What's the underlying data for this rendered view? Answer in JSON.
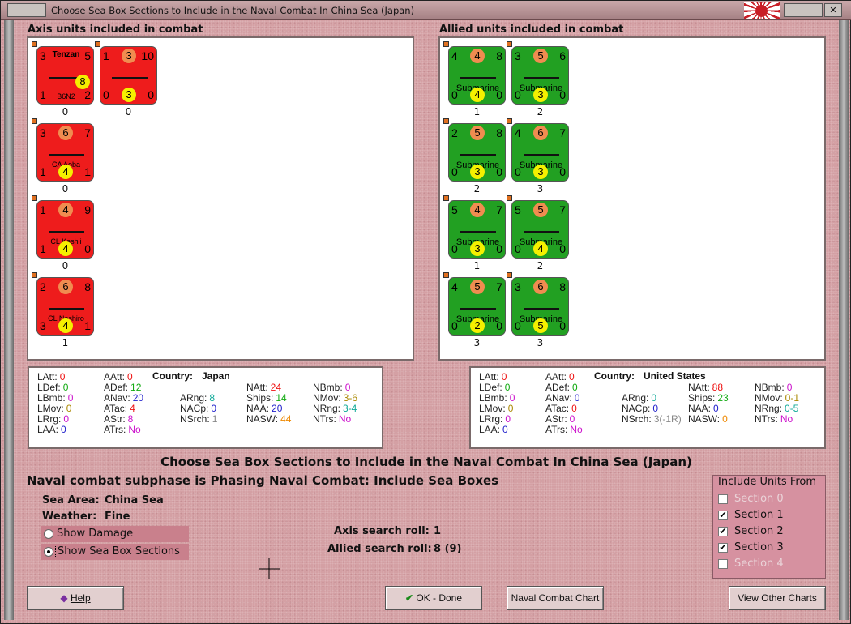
{
  "window": {
    "title": "Choose Sea Box Sections to Include in the Naval Combat In China Sea (Japan)",
    "close": "✕"
  },
  "axis_panel": {
    "label": "Axis units included in combat",
    "counters": [
      {
        "left": "3",
        "right": "5",
        "top_center": "Tenzan",
        "name": "B6N2",
        "bottom_left": "1",
        "bottom_right": "2",
        "yellow": "8",
        "below": "0",
        "kind": "air"
      },
      {
        "left": "1",
        "mid": "3",
        "right": "10",
        "name": "",
        "bottom_left": "0",
        "yellow": "3",
        "bottom_right": "0",
        "below": "0",
        "kind": "carrier"
      },
      {
        "left": "3",
        "mid": "6",
        "right": "7",
        "name": "CA Aoba",
        "bottom_left": "1",
        "yellow": "4",
        "bottom_right": "1",
        "below": "0"
      },
      {
        "left": "1",
        "mid": "4",
        "right": "9",
        "name": "CL Kashii",
        "bottom_left": "1",
        "yellow": "4",
        "bottom_right": "0",
        "below": "0"
      },
      {
        "left": "2",
        "mid": "6",
        "right": "8",
        "name": "CL Noshiro",
        "bottom_left": "3",
        "yellow": "4",
        "bottom_right": "1",
        "below": "1"
      }
    ]
  },
  "allied_panel": {
    "label": "Allied units included in combat",
    "counters": [
      {
        "left": "4",
        "mid": "4",
        "right": "8",
        "name": "Submarine",
        "bottom_left": "0",
        "yellow": "4",
        "bottom_right": "0",
        "below": "1"
      },
      {
        "left": "3",
        "mid": "5",
        "right": "6",
        "name": "Submarine",
        "bottom_left": "0",
        "yellow": "3",
        "bottom_right": "0",
        "below": "2"
      },
      {
        "left": "2",
        "mid": "5",
        "right": "8",
        "name": "Submarine",
        "bottom_left": "0",
        "yellow": "3",
        "bottom_right": "0",
        "below": "2"
      },
      {
        "left": "4",
        "mid": "6",
        "right": "7",
        "name": "Submarine",
        "bottom_left": "0",
        "yellow": "3",
        "bottom_right": "0",
        "below": "3"
      },
      {
        "left": "5",
        "mid": "4",
        "right": "7",
        "name": "Submarine",
        "bottom_left": "0",
        "yellow": "3",
        "bottom_right": "0",
        "below": "1"
      },
      {
        "left": "5",
        "mid": "5",
        "right": "7",
        "name": "Submarine",
        "bottom_left": "0",
        "yellow": "4",
        "bottom_right": "0",
        "below": "2"
      },
      {
        "left": "4",
        "mid": "5",
        "right": "7",
        "name": "Submarine",
        "bottom_left": "0",
        "yellow": "2",
        "bottom_right": "0",
        "below": "3"
      },
      {
        "left": "3",
        "mid": "6",
        "right": "8",
        "name": "Submarine",
        "bottom_left": "0",
        "yellow": "5",
        "bottom_right": "0",
        "below": "3"
      }
    ]
  },
  "axis_stats": {
    "country_label": "Country:",
    "country": "Japan",
    "stats": [
      [
        "LAtt:",
        "0",
        "#e11"
      ],
      [
        "LDef:",
        "0",
        "#1a1"
      ],
      [
        "LBmb:",
        "0",
        "#c1c"
      ],
      [
        "LMov:",
        "0",
        "#aa8800"
      ],
      [
        "LRrg:",
        "0",
        "#c1c"
      ],
      [
        "LAA:",
        "0",
        "#22c"
      ],
      [
        "AAtt:",
        "0",
        "#e11"
      ],
      [
        "ADef:",
        "12",
        "#1a1"
      ],
      [
        "ANav:",
        "20",
        "#22c"
      ],
      [
        "ATac:",
        "4",
        "#e11"
      ],
      [
        "AStr:",
        "8",
        "#c1c"
      ],
      [
        "ATrs:",
        "No",
        "#c1c"
      ],
      [
        "ARng:",
        "8",
        "#1a9"
      ],
      [
        "NACp:",
        "0",
        "#22c"
      ],
      [
        "NSrch:",
        "1",
        "#888"
      ],
      [
        "NAtt:",
        "24",
        "#e11"
      ],
      [
        "Ships:",
        "14",
        "#1a1"
      ],
      [
        "NAA:",
        "20",
        "#22c"
      ],
      [
        "NASW:",
        "44",
        "#e80"
      ],
      [
        "NBmb:",
        "0",
        "#c1c"
      ],
      [
        "NMov:",
        "3-6",
        "#aa8800"
      ],
      [
        "NRng:",
        "3-4",
        "#1a9"
      ],
      [
        "NTrs:",
        "No",
        "#c1c"
      ]
    ]
  },
  "allied_stats": {
    "country_label": "Country:",
    "country": "United States",
    "stats": [
      [
        "LAtt:",
        "0",
        "#e11"
      ],
      [
        "LDef:",
        "0",
        "#1a1"
      ],
      [
        "LBmb:",
        "0",
        "#c1c"
      ],
      [
        "LMov:",
        "0",
        "#aa8800"
      ],
      [
        "LRrg:",
        "0",
        "#c1c"
      ],
      [
        "LAA:",
        "0",
        "#22c"
      ],
      [
        "AAtt:",
        "0",
        "#e11"
      ],
      [
        "ADef:",
        "0",
        "#1a1"
      ],
      [
        "ANav:",
        "0",
        "#22c"
      ],
      [
        "ATac:",
        "0",
        "#e11"
      ],
      [
        "AStr:",
        "0",
        "#c1c"
      ],
      [
        "ATrs:",
        "No",
        "#c1c"
      ],
      [
        "ARng:",
        "0",
        "#1a9"
      ],
      [
        "NACp:",
        "0",
        "#22c"
      ],
      [
        "NSrch:",
        "3(-1R)",
        "#888"
      ],
      [
        "NAtt:",
        "88",
        "#e11"
      ],
      [
        "Ships:",
        "23",
        "#1a1"
      ],
      [
        "NAA:",
        "0",
        "#22c"
      ],
      [
        "NASW:",
        "0",
        "#e80"
      ],
      [
        "NBmb:",
        "0",
        "#c1c"
      ],
      [
        "NMov:",
        "0-1",
        "#aa8800"
      ],
      [
        "NRng:",
        "0-5",
        "#1a9"
      ],
      [
        "NTrs:",
        "No",
        "#c1c"
      ]
    ]
  },
  "heading": "Choose Sea Box Sections to Include in the Naval Combat In China Sea (Japan)",
  "subphase": "Naval combat subphase is Phasing Naval Combat: Include Sea Boxes",
  "sea_area_label": "Sea Area:",
  "sea_area": "China Sea",
  "weather_label": "Weather:",
  "weather": "Fine",
  "radio1": "Show Damage",
  "radio2": "Show Sea Box Sections",
  "axis_roll_label": "Axis search roll:",
  "axis_roll": "1",
  "allied_roll_label": "Allied search roll:",
  "allied_roll": "8 (9)",
  "include": {
    "title": "Include Units From",
    "sections": [
      {
        "label": "Section 0",
        "checked": false
      },
      {
        "label": "Section 1",
        "checked": true
      },
      {
        "label": "Section 2",
        "checked": true
      },
      {
        "label": "Section 3",
        "checked": true
      },
      {
        "label": "Section 4",
        "checked": false
      }
    ]
  },
  "buttons": {
    "help": "Help",
    "ok": "OK - Done",
    "naval": "Naval Combat Chart",
    "other": "View Other Charts"
  }
}
